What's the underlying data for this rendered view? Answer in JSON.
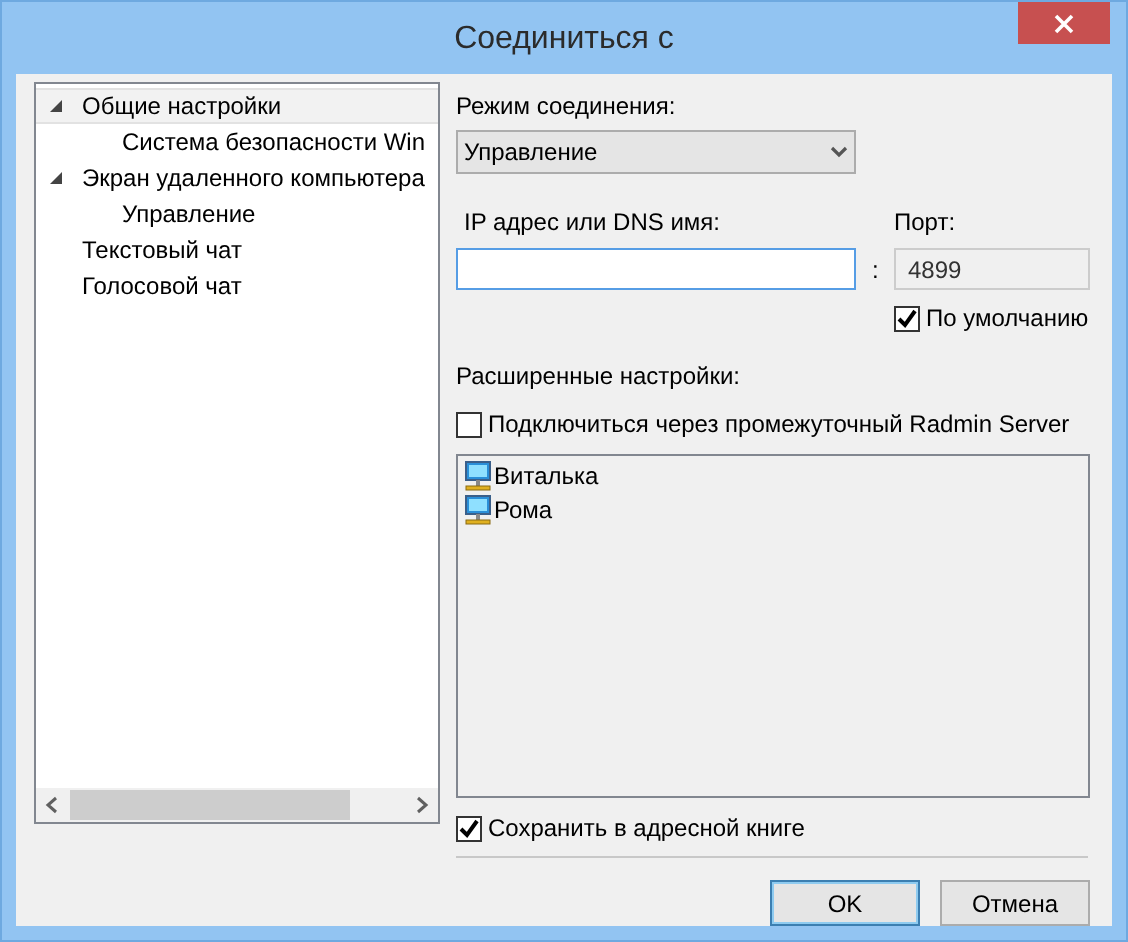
{
  "window": {
    "title": "Соединиться с"
  },
  "tree": [
    {
      "label": "Общие настройки",
      "selected": true,
      "expanded": true,
      "children": [
        {
          "label": "Система безопасности Win",
          "selected": false
        }
      ]
    },
    {
      "label": "Экран удаленного компьютера",
      "selected": false,
      "expanded": true,
      "children": [
        {
          "label": "Управление",
          "selected": false
        }
      ]
    },
    {
      "label": "Текстовый чат",
      "selected": false
    },
    {
      "label": "Голосовой чат",
      "selected": false
    }
  ],
  "mode": {
    "label": "Режим соединения:",
    "value": "Управление"
  },
  "address": {
    "label": "IP адрес или DNS имя:"
  },
  "separator": ":",
  "port": {
    "label": "Порт:",
    "value": "4899",
    "disabled": true
  },
  "default_port": {
    "label": "По умолчанию",
    "checked": true
  },
  "advanced": {
    "label": "Расширенные настройки:"
  },
  "via_server": {
    "label": "Подключиться через промежуточный Radmin Server",
    "checked": false
  },
  "servers": [
    {
      "label": "Виталька"
    },
    {
      "label": "Рома"
    }
  ],
  "save": {
    "label": "Сохранить в адресной книге",
    "checked": true
  },
  "buttons": [
    {
      "label": "OK",
      "kind": "default"
    },
    {
      "label": "Отмена",
      "kind": "normal"
    }
  ]
}
